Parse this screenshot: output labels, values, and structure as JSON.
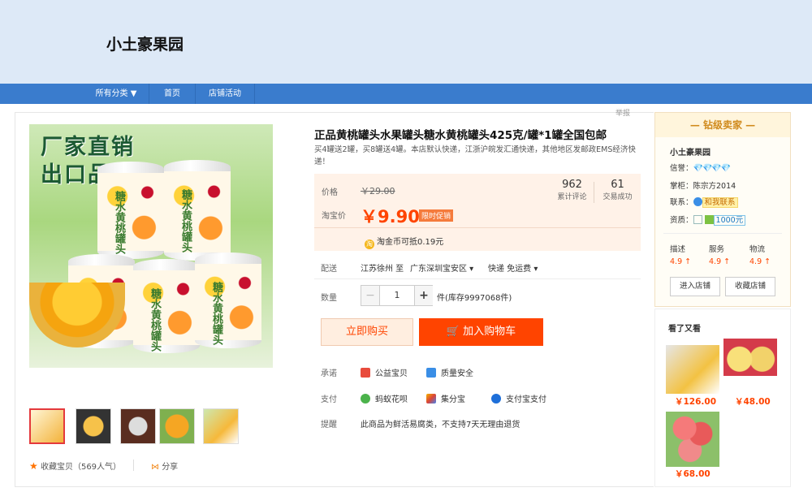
{
  "header": {
    "shop_name": "小土豪果园"
  },
  "nav": {
    "items": [
      "所有分类 ▼",
      "首页",
      "店铺活动"
    ]
  },
  "report": "举报",
  "image": {
    "promo_line1": "厂家直销",
    "promo_line2": "出口品质",
    "can_text": "糖水黄桃罐头"
  },
  "product": {
    "title": "正品黄桃罐头水果罐头糖水黄桃罐头425克/罐*1罐全国包邮",
    "subtitle": "买4罐送2罐，买8罐送4罐。本店默认快递，江浙沪皖发汇通快递，其他地区发邮政EMS经济快递！",
    "price_label": "价格",
    "old_price": "￥29.00",
    "tb_price_label": "淘宝价",
    "price": "￥9.90",
    "price_tag": "限时促销",
    "reviews": {
      "count": "962",
      "label": "累计评论"
    },
    "deals": {
      "count": "61",
      "label": "交易成功"
    },
    "coin": "淘金币可抵0.19元",
    "shipping": {
      "label": "配送",
      "from": "江苏徐州 至",
      "to": "广东深圳宝安区 ▾",
      "method": "快递 免运费 ▾"
    },
    "qty": {
      "label": "数量",
      "minus": "−",
      "value": "1",
      "plus": "+",
      "stock": "件(库存9997068件)"
    },
    "buy_label": "立即购买",
    "cart_label": "加入购物车",
    "promise": {
      "label": "承诺",
      "items": [
        "公益宝贝",
        "质量安全"
      ]
    },
    "pay": {
      "label": "支付",
      "items": [
        "蚂蚁花呗",
        "集分宝",
        "支付宝支付"
      ]
    },
    "notice": {
      "label": "提醒",
      "text": "此商品为鲜活易腐类，不支持7天无理由退货"
    }
  },
  "actions": {
    "fav": "收藏宝贝（569人气）",
    "share": "分享"
  },
  "seller": {
    "header": "— 钻级卖家 —",
    "name": "小土豪果园",
    "credit_label": "信誉：",
    "credit_icons": "💎💎💎💎",
    "keeper": "掌柜：陈宗方2014",
    "contact_label": "联系：",
    "contact_btn": "和我联系",
    "qual_label": "资质：",
    "qual_value": "1000元",
    "scores": [
      {
        "name": "描述",
        "value": "4.9 ↑"
      },
      {
        "name": "服务",
        "value": "4.9 ↑"
      },
      {
        "name": "物流",
        "value": "4.9 ↑"
      }
    ],
    "enter_shop": "进入店铺",
    "fav_shop": "收藏店铺"
  },
  "also_seen": {
    "title": "看了又看",
    "items": [
      {
        "price": "￥126.00"
      },
      {
        "price": "￥48.00"
      },
      {
        "price": "￥68.00"
      }
    ]
  }
}
